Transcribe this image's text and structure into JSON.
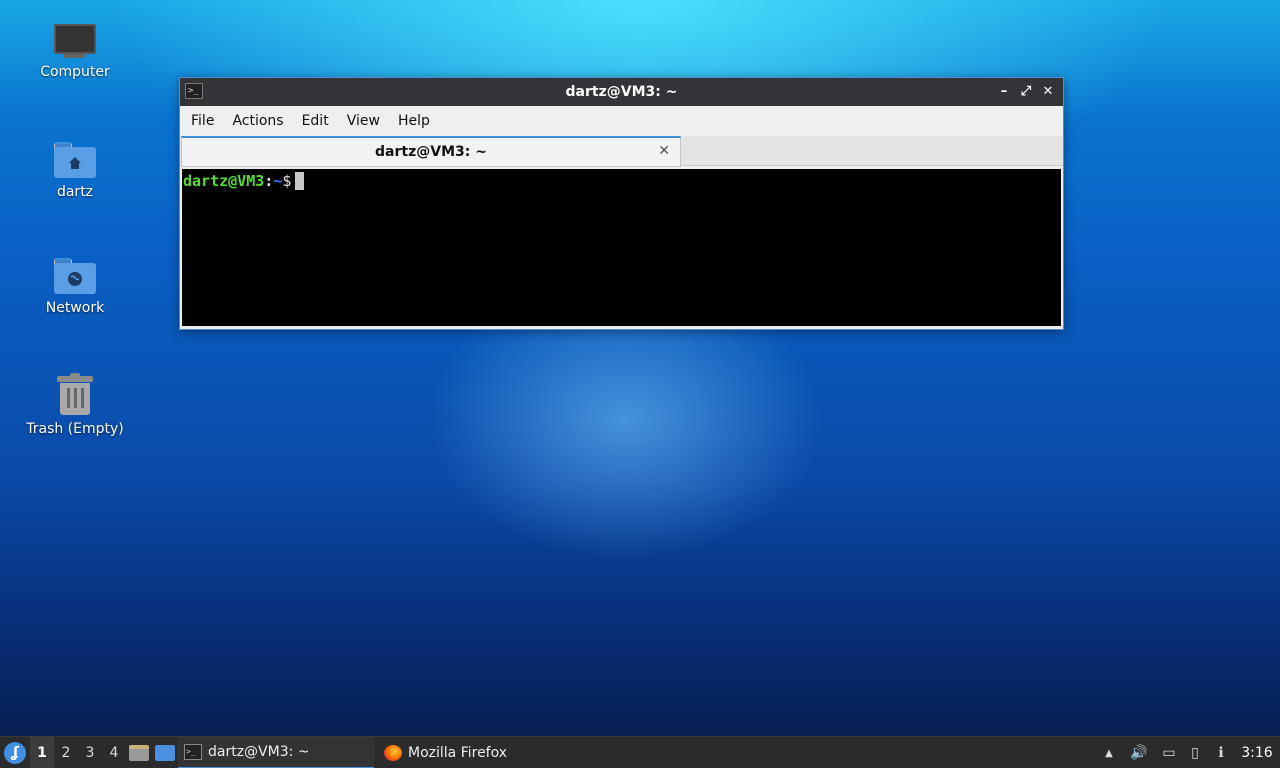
{
  "desktop": {
    "icons": [
      {
        "label": "Computer"
      },
      {
        "label": "dartz"
      },
      {
        "label": "Network"
      },
      {
        "label": "Trash (Empty)"
      }
    ]
  },
  "window": {
    "title": "dartz@VM3: ~",
    "controls": {
      "minimize": "–",
      "maximize": "⤢",
      "close": "✕"
    },
    "menu": [
      "File",
      "Actions",
      "Edit",
      "View",
      "Help"
    ],
    "tab": {
      "label": "dartz@VM3: ~",
      "close": "✕"
    },
    "prompt": {
      "user_host": "dartz@VM3",
      "colon": ":",
      "path": "~",
      "symbol": "$"
    }
  },
  "taskbar": {
    "start_glyph": "ʆ",
    "workspaces": [
      "1",
      "2",
      "3",
      "4"
    ],
    "active_workspace": "1",
    "tasks": [
      {
        "label": "dartz@VM3: ~",
        "icon": "terminal-icon",
        "active": true
      },
      {
        "label": "Mozilla Firefox",
        "icon": "firefox-icon",
        "active": false
      }
    ],
    "tray": {
      "up_arrow": "▲",
      "volume": "🔊",
      "network": "▭",
      "clipboard": "▯",
      "notify": "ℹ"
    },
    "clock": "3:16"
  }
}
